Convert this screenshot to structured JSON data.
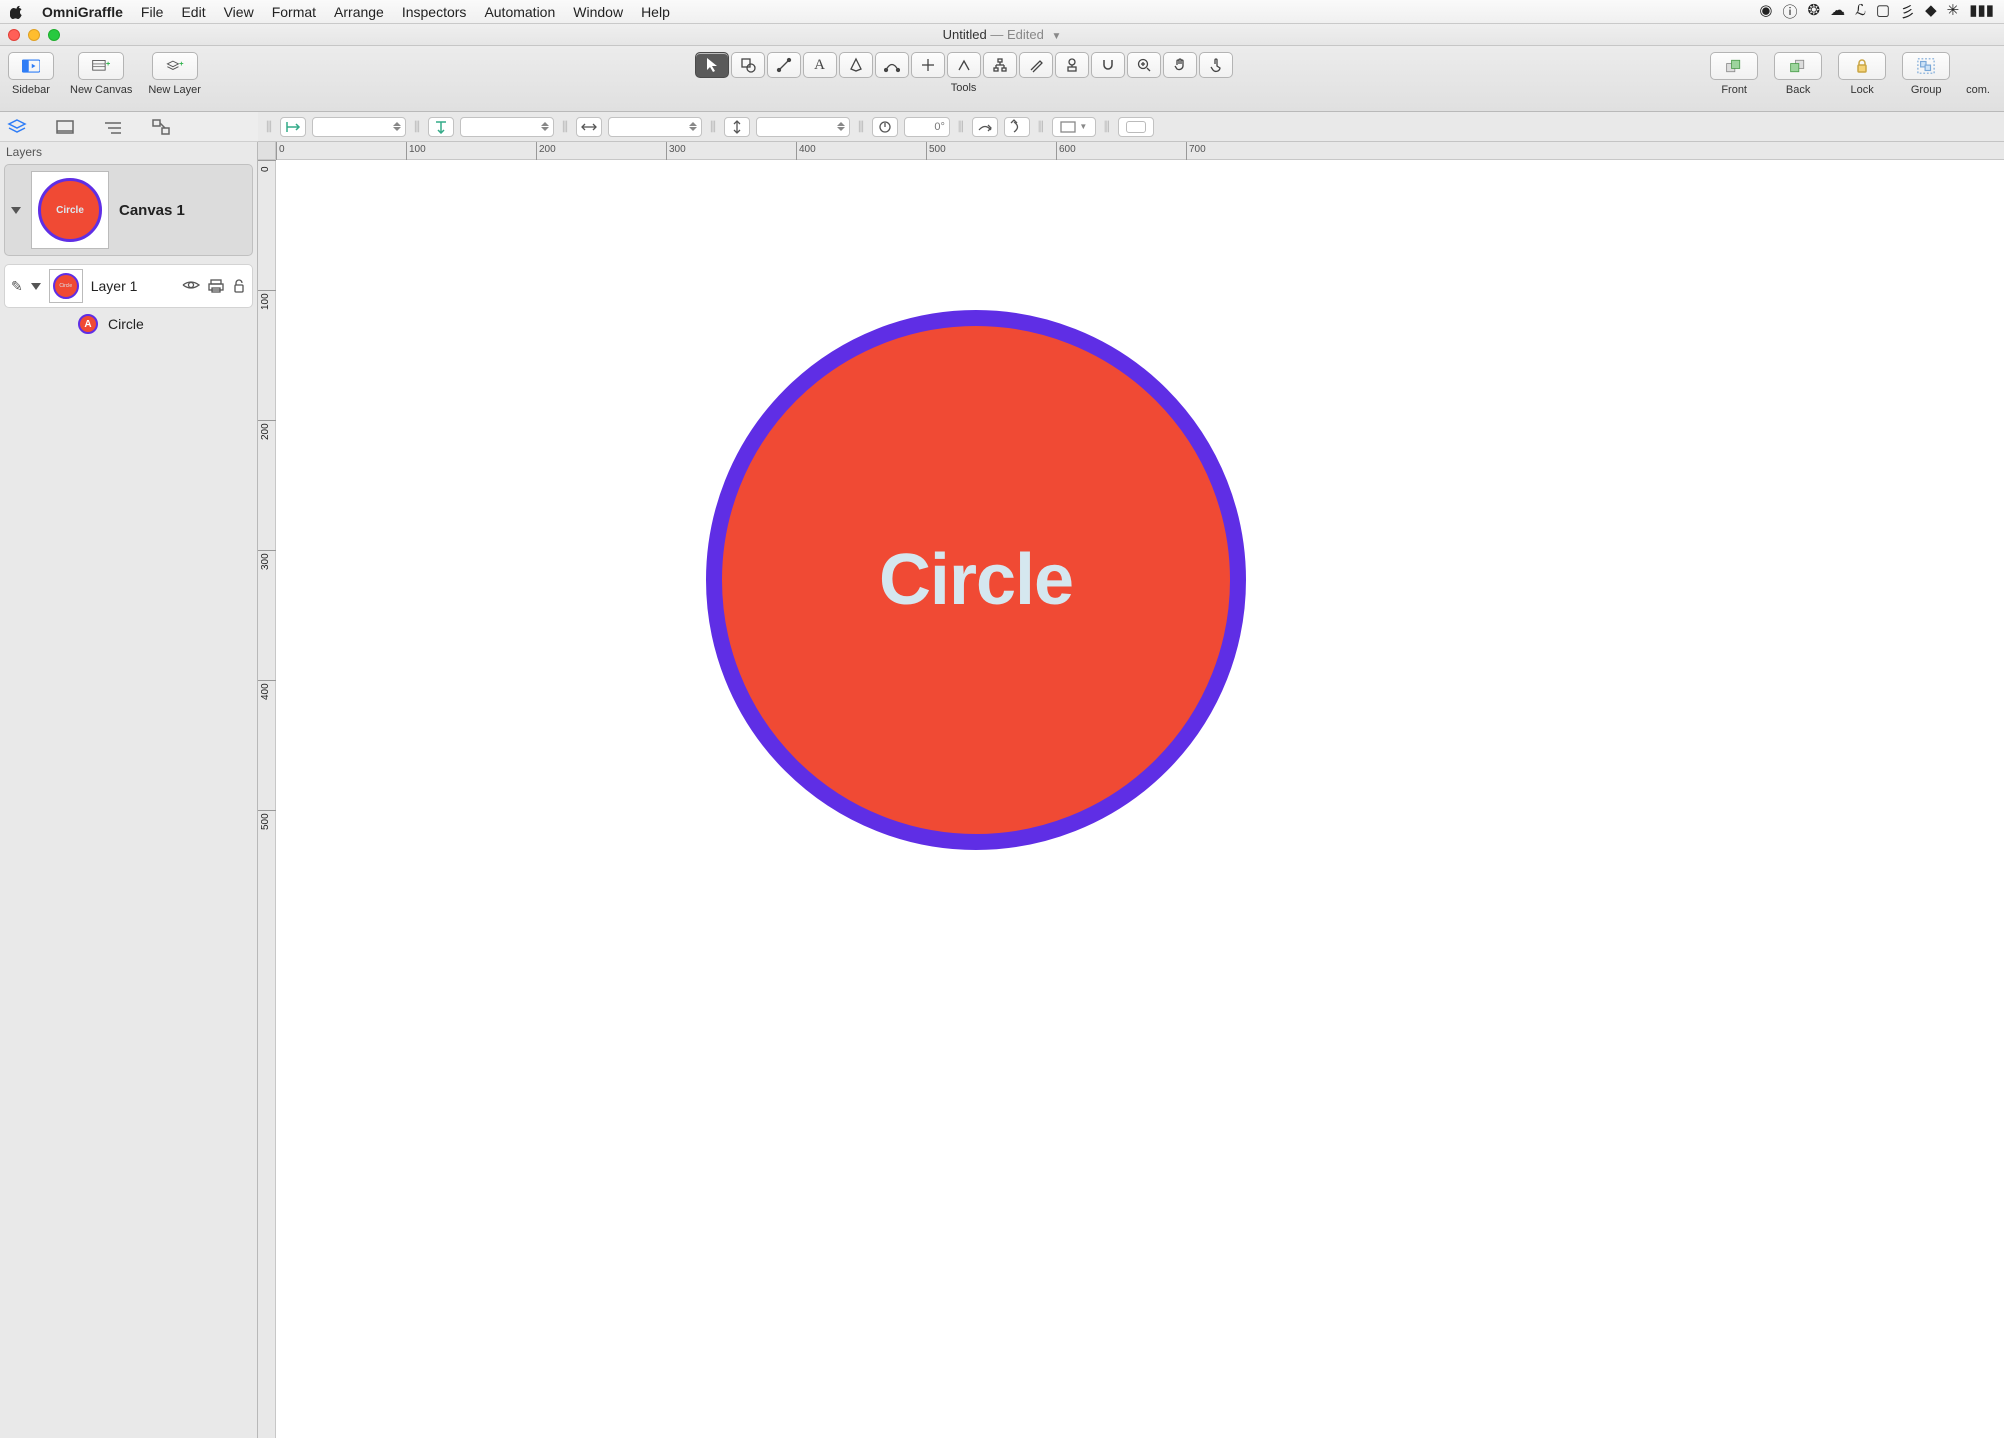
{
  "menubar": {
    "app": "OmniGraffle",
    "items": [
      "File",
      "Edit",
      "View",
      "Format",
      "Arrange",
      "Inspectors",
      "Automation",
      "Window",
      "Help"
    ]
  },
  "window": {
    "title": "Untitled",
    "edited": "— Edited"
  },
  "toolbar": {
    "sidebar": "Sidebar",
    "new_canvas": "New Canvas",
    "new_layer": "New Layer",
    "tools_label": "Tools",
    "front": "Front",
    "back": "Back",
    "lock": "Lock",
    "group": "Group",
    "overflow": "com."
  },
  "formatbar": {
    "rotation": "0°"
  },
  "sidebar": {
    "header": "Layers",
    "canvas_name": "Canvas 1",
    "canvas_thumb_text": "Circle",
    "layer_name": "Layer 1",
    "layer_thumb_text": "Circle",
    "object_name": "Circle",
    "object_badge": "A"
  },
  "canvas": {
    "shape_label": "Circle",
    "circle_fill": "#f04a34",
    "circle_stroke": "#5f2ee5",
    "ruler_ticks_h": [
      "0",
      "100",
      "200",
      "300",
      "400",
      "500",
      "600",
      "700"
    ],
    "ruler_ticks_v": [
      "0",
      "100",
      "200",
      "300",
      "400",
      "500"
    ]
  }
}
